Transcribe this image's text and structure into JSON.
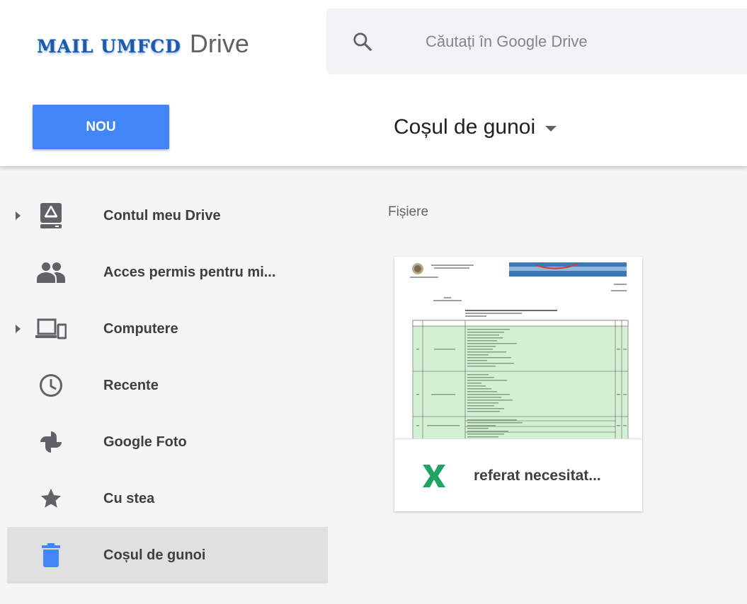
{
  "header": {
    "logo_text": "MAIL UMFCD",
    "app_name": "Drive",
    "search": {
      "placeholder": "Căutați în Google Drive"
    },
    "new_button": "NOU",
    "page_title": "Coșul de gunoi"
  },
  "sidebar": {
    "items": [
      {
        "label": "Contul meu Drive",
        "icon": "my-drive-icon",
        "expandable": true
      },
      {
        "label": "Acces permis pentru mi...",
        "icon": "shared-people-icon",
        "expandable": false
      },
      {
        "label": "Computere",
        "icon": "computers-icon",
        "expandable": true
      },
      {
        "label": "Recente",
        "icon": "clock-icon",
        "expandable": false
      },
      {
        "label": "Google Foto",
        "icon": "pinwheel-icon",
        "expandable": false
      },
      {
        "label": "Cu stea",
        "icon": "star-icon",
        "expandable": false
      },
      {
        "label": "Coșul de gunoi",
        "icon": "trash-icon",
        "expandable": false,
        "active": true
      }
    ]
  },
  "main": {
    "section_label": "Fișiere",
    "files": [
      {
        "name": "referat necesitat...",
        "type_icon": "excel-icon"
      }
    ]
  },
  "colors": {
    "primary": "#4285f4",
    "sidebar_bg": "#f5f5f5",
    "active_bg": "#e0e0e0",
    "excel_green": "#1fa463"
  }
}
